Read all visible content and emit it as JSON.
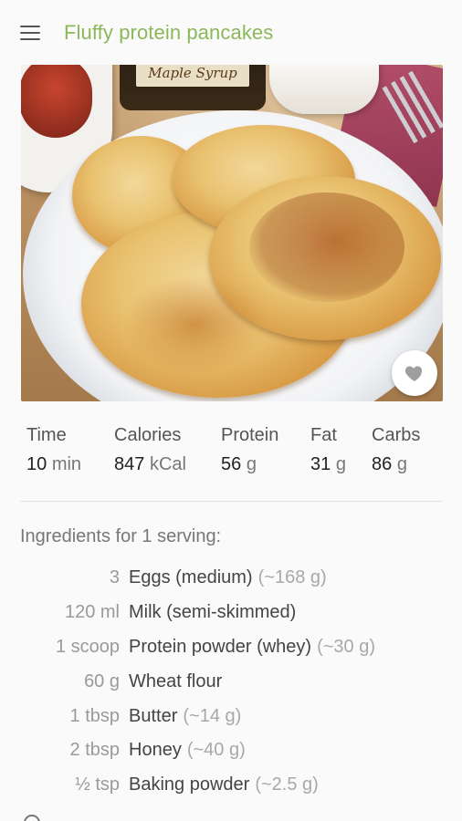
{
  "app_bar": {
    "menu_icon": "hamburger-menu-icon",
    "title": "Fluffy protein pancakes",
    "title_color": "#8bb85a"
  },
  "hero": {
    "jar_label": "Maple Syrup",
    "favorite_icon": "heart-icon"
  },
  "stats": {
    "time": {
      "label": "Time",
      "value": "10",
      "unit": "min"
    },
    "calories": {
      "label": "Calories",
      "value": "847",
      "unit": "kCal"
    },
    "protein": {
      "label": "Protein",
      "value": "56",
      "unit": "g"
    },
    "fat": {
      "label": "Fat",
      "value": "31",
      "unit": "g"
    },
    "carbs": {
      "label": "Carbs",
      "value": "86",
      "unit": "g"
    }
  },
  "ingredients": {
    "title": "Ingredients for 1 serving:",
    "items": [
      {
        "qty": "3",
        "name": "Eggs (medium)",
        "note": "(~168 g)"
      },
      {
        "qty": "120 ml",
        "name": "Milk (semi-skimmed)",
        "note": ""
      },
      {
        "qty": "1 scoop",
        "name": "Protein powder (whey)",
        "note": "(~30 g)"
      },
      {
        "qty": "60 g",
        "name": "Wheat flour",
        "note": ""
      },
      {
        "qty": "1 tbsp",
        "name": "Butter",
        "note": "(~14 g)"
      },
      {
        "qty": "2 tbsp",
        "name": "Honey",
        "note": "(~40 g)"
      },
      {
        "qty": "½ tsp",
        "name": "Baking powder",
        "note": "(~2.5 g)"
      }
    ]
  }
}
